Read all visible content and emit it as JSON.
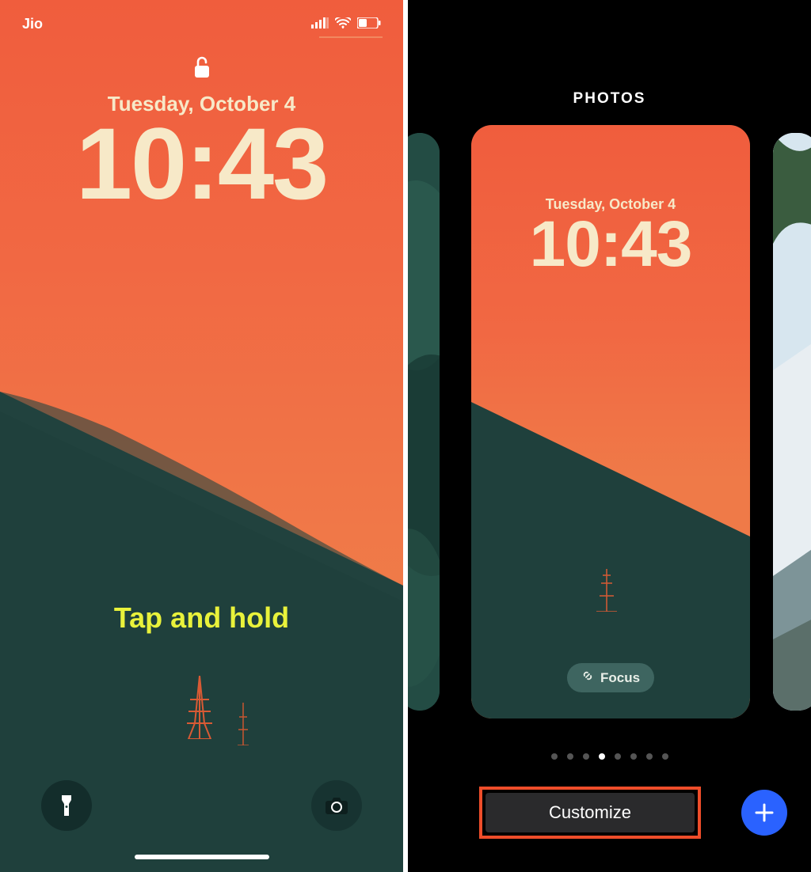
{
  "colors": {
    "sky_top": "#f05d3d",
    "sky_bottom": "#ef7c49",
    "hill": "#1f403c",
    "clock": "#f7e9c8",
    "hint": "#e9f23b",
    "accent_blue": "#2a62ff",
    "highlight_border": "#ee4d2a"
  },
  "left": {
    "status": {
      "carrier": "Jio",
      "signal_icon": "cellular-signal-icon",
      "wifi_icon": "wifi-icon",
      "battery_icon": "battery-icon"
    },
    "lock_icon": "unlocked-icon",
    "date": "Tuesday, October 4",
    "time": "10:43",
    "hint": "Tap and hold",
    "flashlight_icon": "flashlight-icon",
    "camera_icon": "camera-icon"
  },
  "right": {
    "title": "PHOTOS",
    "card": {
      "date": "Tuesday, October 4",
      "time": "10:43",
      "focus_label": "Focus",
      "focus_icon": "link-icon"
    },
    "pager": {
      "count": 8,
      "active_index": 3
    },
    "customize_label": "Customize",
    "add_icon": "plus-icon"
  }
}
